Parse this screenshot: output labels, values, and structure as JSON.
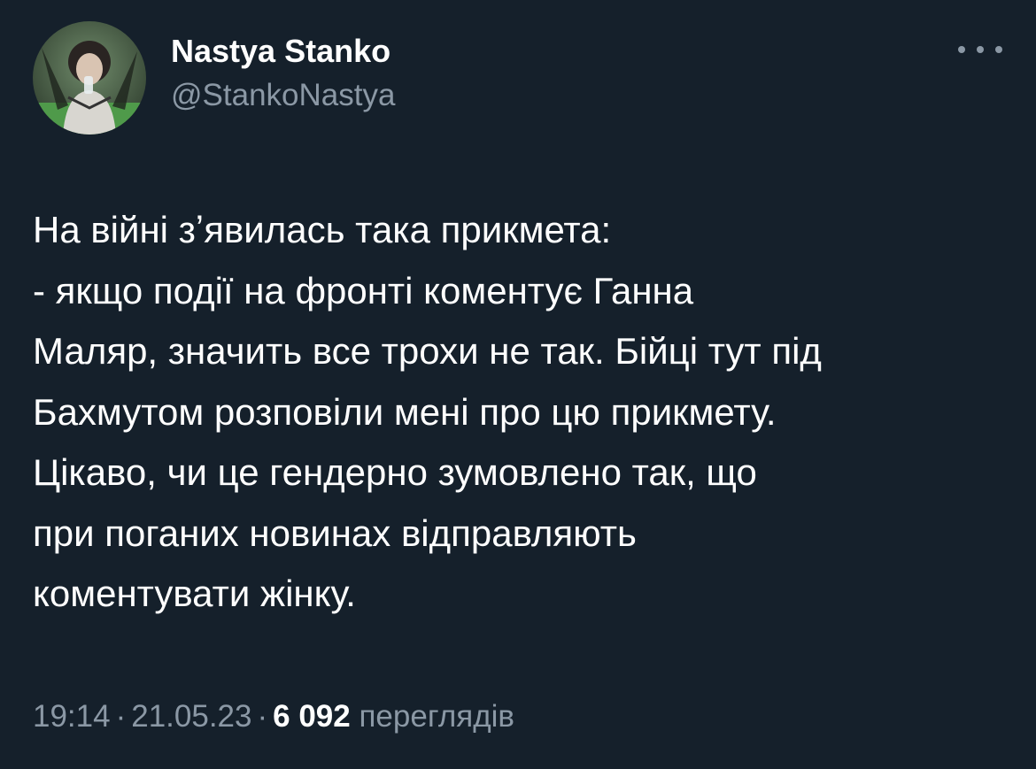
{
  "author": {
    "display_name": "Nastya Stanko",
    "handle": "@StankoNastya",
    "avatar_icon": "profile-photo"
  },
  "more_icon": "more-horizontal-icon",
  "tweet": {
    "text": "На війні зʼявилась така прикмета:\n- якщо події на фронті коментує Ганна\nМаляр, значить все трохи не так. Бійці тут під\nБахмутом розповіли мені про цю прикмету.\nЦікаво, чи це гендерно зумовлено так, що\nпри поганих новинах відправляють\nкоментувати жінку."
  },
  "meta": {
    "time": "19:14",
    "separator": "·",
    "date": "21.05.23",
    "views_count": "6 092",
    "views_label": "переглядів"
  },
  "colors": {
    "background": "#15202b",
    "primary_text": "#ffffff",
    "secondary_text": "#8b98a5"
  }
}
